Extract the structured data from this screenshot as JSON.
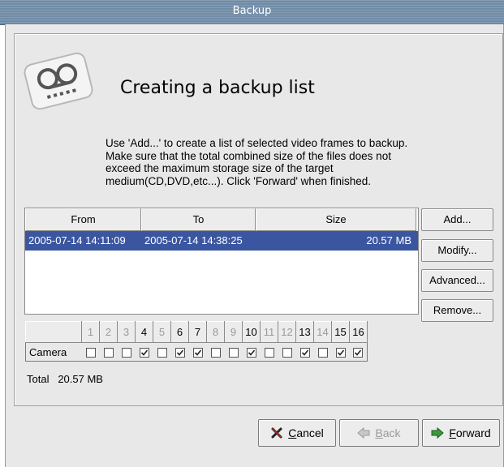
{
  "window": {
    "title": "Backup"
  },
  "header": {
    "title": "Creating a backup list",
    "description": "Use 'Add...' to create a list of selected video frames to backup. Make sure that the total combined size of the files does not exceed the maximum storage size of the target medium(CD,DVD,etc...). Click 'Forward' when finished."
  },
  "list": {
    "columns": [
      "From",
      "To",
      "Size"
    ],
    "rows": [
      {
        "from": "2005-07-14 14:11:09",
        "to": "2005-07-14 14:38:25",
        "size": "20.57 MB",
        "selected": true
      }
    ]
  },
  "side_buttons": {
    "add": "Add...",
    "modify": "Modify...",
    "advanced": "Advanced...",
    "remove": "Remove..."
  },
  "camera_grid": {
    "row_label": "Camera",
    "channels": [
      "1",
      "2",
      "3",
      "4",
      "5",
      "6",
      "7",
      "8",
      "9",
      "10",
      "11",
      "12",
      "13",
      "14",
      "15",
      "16"
    ],
    "enabled": [
      false,
      false,
      false,
      true,
      false,
      true,
      true,
      false,
      false,
      true,
      false,
      false,
      true,
      false,
      true,
      true
    ],
    "checked": [
      false,
      false,
      false,
      true,
      false,
      true,
      true,
      false,
      false,
      true,
      false,
      false,
      true,
      false,
      true,
      true
    ]
  },
  "total": {
    "label": "Total",
    "value": "20.57 MB"
  },
  "footer": {
    "cancel_label": "Cancel",
    "back_label": "Back",
    "forward_label": "Forward"
  },
  "colors": {
    "selection": "#3b56a1",
    "titlebar": "#6f8ba6",
    "dialog_bg": "#e8e8e8"
  },
  "icons": [
    "tape-icon",
    "cancel-x-icon",
    "back-arrow-icon",
    "forward-arrow-icon",
    "checkmark-icon"
  ]
}
